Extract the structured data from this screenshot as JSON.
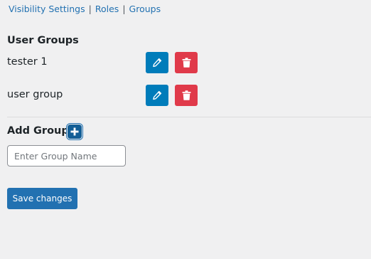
{
  "subnav": {
    "items": [
      "Visibility Settings",
      "Roles",
      "Groups"
    ],
    "separator": "|"
  },
  "groups_section": {
    "title": "User Groups",
    "groups": [
      {
        "name": "tester 1",
        "edit_icon": "pencil-icon",
        "delete_icon": "trash-icon"
      },
      {
        "name": "user group",
        "edit_icon": "pencil-icon",
        "delete_icon": "trash-icon"
      }
    ]
  },
  "add_group": {
    "title": "Add Group",
    "add_icon": "plus-icon",
    "input_value": "",
    "input_placeholder": "Enter Group Name"
  },
  "actions": {
    "save_label": "Save changes"
  },
  "colors": {
    "background": "#f0f0f1",
    "link": "#2271b1",
    "edit_button": "#007cba",
    "delete_button": "#e03a4a",
    "primary_button": "#2271b1"
  }
}
